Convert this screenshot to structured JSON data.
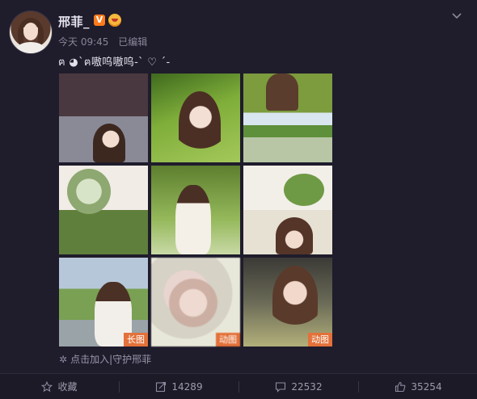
{
  "post": {
    "username": "邢菲_",
    "badge_v": "V",
    "time": "今天 09:45",
    "edited": "已编辑",
    "text": "ฅ ◕`ฅ嗷呜嗷呜-` ♡ ´-",
    "guard_text": "点击加入|守护邢菲"
  },
  "tiles": [
    {
      "tag": ""
    },
    {
      "tag": ""
    },
    {
      "tag": ""
    },
    {
      "tag": ""
    },
    {
      "tag": ""
    },
    {
      "tag": ""
    },
    {
      "tag": "长图"
    },
    {
      "tag": "动图"
    },
    {
      "tag": "动图"
    }
  ],
  "footer": {
    "favorite": "收藏",
    "repost": "14289",
    "comment": "22532",
    "like": "35254"
  },
  "colors": {
    "background": "#1f1c2c",
    "tag": "#e3713a",
    "verified": "#ff7a1a"
  }
}
